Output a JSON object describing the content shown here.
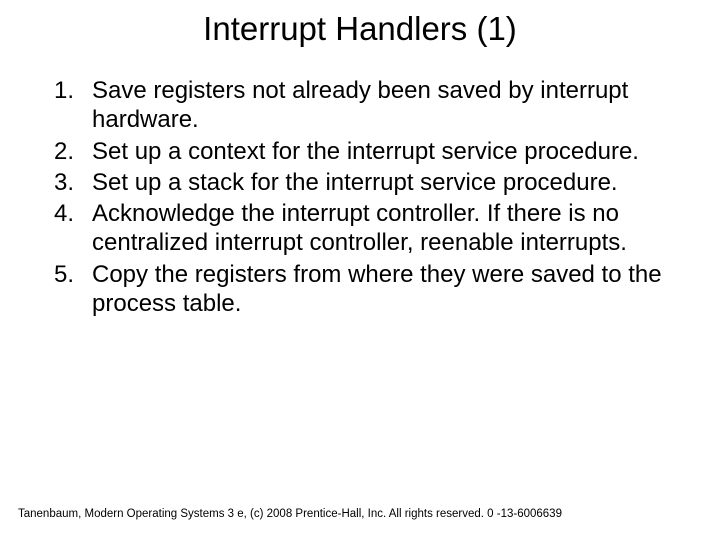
{
  "title": "Interrupt Handlers (1)",
  "items": [
    {
      "n": "1.",
      "t": "Save registers not already been saved by interrupt hardware."
    },
    {
      "n": "2.",
      "t": "Set up a context for the interrupt service procedure."
    },
    {
      "n": "3.",
      "t": "Set up a stack for the interrupt service procedure."
    },
    {
      "n": "4.",
      "t": "Acknowledge the interrupt controller. If there is no centralized interrupt controller, reenable interrupts."
    },
    {
      "n": "5.",
      "t": "Copy the registers from where they were saved to the process table."
    }
  ],
  "footer": "Tanenbaum, Modern Operating Systems 3 e, (c) 2008 Prentice-Hall, Inc. All rights reserved. 0 -13-6006639"
}
